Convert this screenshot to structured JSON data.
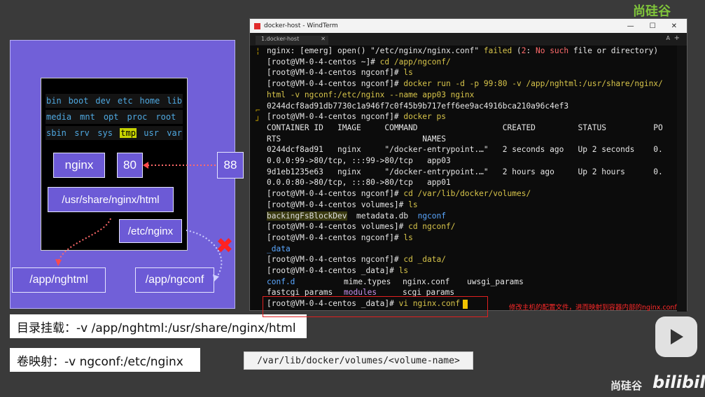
{
  "diagram": {
    "container_dirs": [
      [
        "bin",
        "boot",
        "dev",
        "etc",
        "home",
        "lib"
      ],
      [
        "media",
        "mnt",
        "opt",
        "proc",
        "root"
      ],
      [
        "sbin",
        "srv",
        "sys",
        "tmp",
        "usr",
        "var"
      ]
    ],
    "highlighted_dir": "tmp",
    "nginx_label": "nginx",
    "container_port": "80",
    "host_port": "88",
    "html_path": "/usr/share/nginx/html",
    "etc_path": "/etc/nginx",
    "host_html_dir": "/app/nghtml",
    "host_conf_dir": "/app/ngconf",
    "cross_glyph": "✖"
  },
  "captions": {
    "dir_mount": "目录挂载：-v /app/nghtml:/usr/share/nginx/html",
    "vol_mapping": "卷映射：-v ngconf:/etc/nginx",
    "volume_path": "/var/lib/docker/volumes/<volume-name>"
  },
  "window": {
    "title": "docker-host - WindTerm",
    "tab": "1.docker-host",
    "tab_close": "✕",
    "controls": [
      "—",
      "☐",
      "✕"
    ],
    "tab_tools": [
      "A",
      "+"
    ]
  },
  "terminal": {
    "l0": [
      "nginx: [emerg] open() \"/etc/nginx/nginx.conf\" ",
      "failed",
      " (",
      "2",
      ": ",
      "No such",
      " file or directory)"
    ],
    "prompt_home": "[root@VM-0-4-centos ~]# ",
    "prompt_ngconf": "[root@VM-0-4-centos ngconf]# ",
    "prompt_volumes": "[root@VM-0-4-centos volumes]# ",
    "prompt_data": "[root@VM-0-4-centos _data]# ",
    "cmd_cd_app": "cd /app/ngconf/",
    "cmd_ls": "ls",
    "cmd_run_a": "docker run -d -p 99:80 -v /app/nghtml:/usr/share/nginx/",
    "cmd_run_b": "html -v ngconf:/etc/nginx --name app03 nginx",
    "container_id": "0244dcf8ad91db7730c1a946f7c0f45b9b717eff6ee9ac4916bca210a96c4ef3",
    "cmd_ps": "docker ps",
    "ps_header": "CONTAINER ID   IMAGE     COMMAND                  CREATED         STATUS          PO",
    "ps_header2": "RTS                              NAMES",
    "ps_r1": "0244dcf8ad91   nginx     \"/docker-entrypoint.…\"   2 seconds ago   Up 2 seconds    0.",
    "ps_r1b": "0.0.0:99->80/tcp, :::99->80/tcp   app03",
    "ps_r2": "9d1eb1235e63   nginx     \"/docker-entrypoint.…\"   2 hours ago     Up 2 hours      0.",
    "ps_r2b": "0.0.0:80->80/tcp, :::80->80/tcp   app01",
    "cmd_cd_vol": "cd /var/lib/docker/volumes/",
    "ls_vol": [
      "backingFsBlockDev",
      "metadata.db",
      "ngconf"
    ],
    "cmd_cd_ngconf": "cd ngconf/",
    "ls_ngconf": "_data",
    "cmd_cd_data": "cd _data/",
    "ls_data_1": [
      "conf.d",
      "mime.types",
      "nginx.conf",
      "uwsgi_params"
    ],
    "ls_data_2": [
      "fastcgi_params",
      "modules",
      "scgi_params"
    ],
    "cmd_vi": "vi nginx.conf"
  },
  "annotation_note": "修改主机的配置文件，进而映射到容器内部的nginx.conf",
  "branding": {
    "logo_text": "尚硅谷",
    "bili_text": "bilibili",
    "top_logo": "尚硅谷"
  },
  "colors": {
    "diagram_bg": "#7160d8",
    "terminal_bg": "#0c0c0c",
    "note_red": "#ff2a2a"
  }
}
